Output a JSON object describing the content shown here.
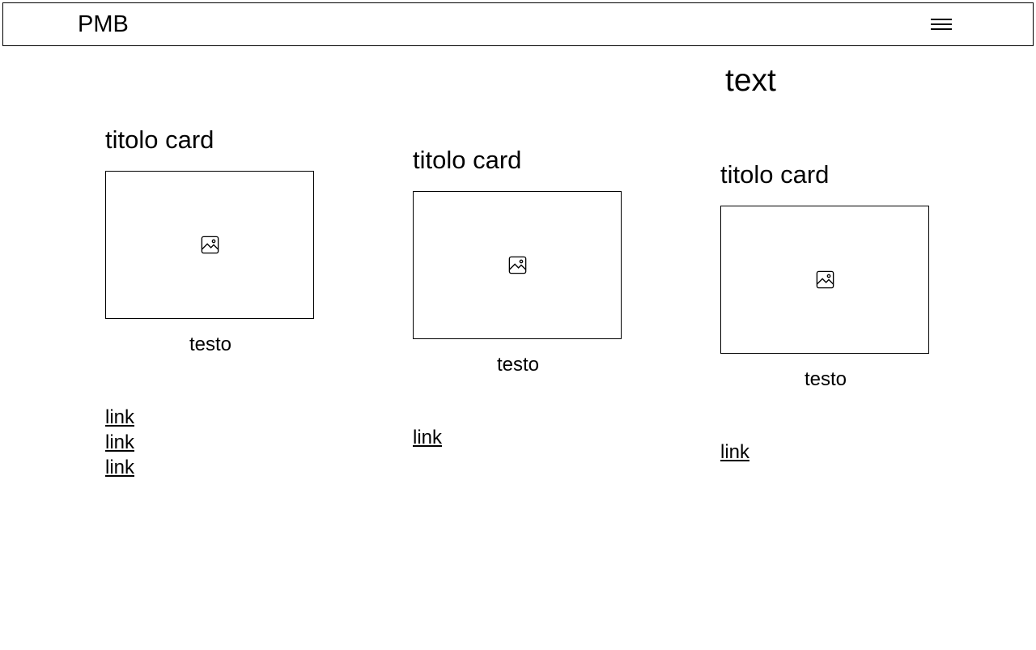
{
  "header": {
    "logo": "PMB"
  },
  "page": {
    "heading": "text"
  },
  "cards": [
    {
      "title": "titolo card",
      "text": "testo",
      "links": [
        "link",
        "link",
        "link"
      ]
    },
    {
      "title": "titolo card",
      "text": "testo",
      "links": [
        "link"
      ]
    },
    {
      "title": "titolo card",
      "text": "testo",
      "links": [
        "link"
      ]
    }
  ]
}
